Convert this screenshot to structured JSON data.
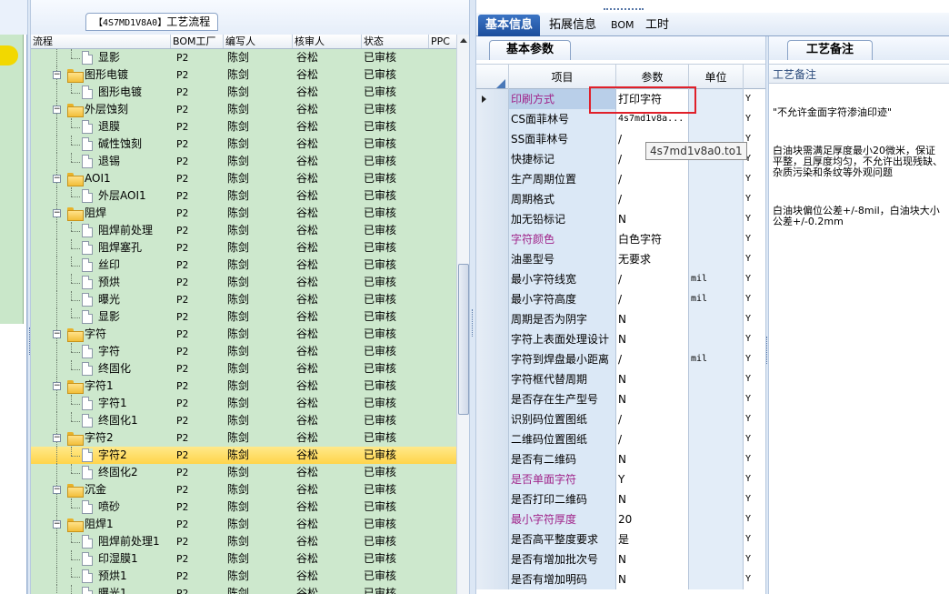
{
  "tree_panel": {
    "title_code": "【4S7MD1V8A0】",
    "title_text": "工艺流程",
    "columns": [
      "流程",
      "BOM工厂",
      "编写人",
      "核审人",
      "状态",
      "PPC"
    ],
    "rows": [
      {
        "name": "显影",
        "level": 2,
        "bom": "P2",
        "writer": "陈剑",
        "reviewer": "谷松",
        "status": "已审核"
      },
      {
        "name": "图形电镀",
        "level": 1,
        "bom": "P2",
        "writer": "陈剑",
        "reviewer": "谷松",
        "status": "已审核"
      },
      {
        "name": "图形电镀",
        "level": 2,
        "bom": "P2",
        "writer": "陈剑",
        "reviewer": "谷松",
        "status": "已审核"
      },
      {
        "name": "外层蚀刻",
        "level": 1,
        "bom": "P2",
        "writer": "陈剑",
        "reviewer": "谷松",
        "status": "已审核"
      },
      {
        "name": "退膜",
        "level": 2,
        "bom": "P2",
        "writer": "陈剑",
        "reviewer": "谷松",
        "status": "已审核"
      },
      {
        "name": "碱性蚀刻",
        "level": 2,
        "bom": "P2",
        "writer": "陈剑",
        "reviewer": "谷松",
        "status": "已审核"
      },
      {
        "name": "退锡",
        "level": 2,
        "bom": "P2",
        "writer": "陈剑",
        "reviewer": "谷松",
        "status": "已审核"
      },
      {
        "name": "AOI1",
        "level": 1,
        "bom": "P2",
        "writer": "陈剑",
        "reviewer": "谷松",
        "status": "已审核"
      },
      {
        "name": "外层AOI1",
        "level": 2,
        "bom": "P2",
        "writer": "陈剑",
        "reviewer": "谷松",
        "status": "已审核"
      },
      {
        "name": "阻焊",
        "level": 1,
        "bom": "P2",
        "writer": "陈剑",
        "reviewer": "谷松",
        "status": "已审核"
      },
      {
        "name": "阻焊前处理",
        "level": 2,
        "bom": "P2",
        "writer": "陈剑",
        "reviewer": "谷松",
        "status": "已审核"
      },
      {
        "name": "阻焊塞孔",
        "level": 2,
        "bom": "P2",
        "writer": "陈剑",
        "reviewer": "谷松",
        "status": "已审核"
      },
      {
        "name": "丝印",
        "level": 2,
        "bom": "P2",
        "writer": "陈剑",
        "reviewer": "谷松",
        "status": "已审核"
      },
      {
        "name": "预烘",
        "level": 2,
        "bom": "P2",
        "writer": "陈剑",
        "reviewer": "谷松",
        "status": "已审核"
      },
      {
        "name": "曝光",
        "level": 2,
        "bom": "P2",
        "writer": "陈剑",
        "reviewer": "谷松",
        "status": "已审核"
      },
      {
        "name": "显影",
        "level": 2,
        "bom": "P2",
        "writer": "陈剑",
        "reviewer": "谷松",
        "status": "已审核"
      },
      {
        "name": "字符",
        "level": 1,
        "bom": "P2",
        "writer": "陈剑",
        "reviewer": "谷松",
        "status": "已审核"
      },
      {
        "name": "字符",
        "level": 2,
        "bom": "P2",
        "writer": "陈剑",
        "reviewer": "谷松",
        "status": "已审核"
      },
      {
        "name": "终固化",
        "level": 2,
        "bom": "P2",
        "writer": "陈剑",
        "reviewer": "谷松",
        "status": "已审核"
      },
      {
        "name": "字符1",
        "level": 1,
        "bom": "P2",
        "writer": "陈剑",
        "reviewer": "谷松",
        "status": "已审核"
      },
      {
        "name": "字符1",
        "level": 2,
        "bom": "P2",
        "writer": "陈剑",
        "reviewer": "谷松",
        "status": "已审核"
      },
      {
        "name": "终固化1",
        "level": 2,
        "bom": "P2",
        "writer": "陈剑",
        "reviewer": "谷松",
        "status": "已审核"
      },
      {
        "name": "字符2",
        "level": 1,
        "bom": "P2",
        "writer": "陈剑",
        "reviewer": "谷松",
        "status": "已审核"
      },
      {
        "name": "字符2",
        "level": 2,
        "bom": "P2",
        "writer": "陈剑",
        "reviewer": "谷松",
        "status": "已审核",
        "selected": true
      },
      {
        "name": "终固化2",
        "level": 2,
        "bom": "P2",
        "writer": "陈剑",
        "reviewer": "谷松",
        "status": "已审核"
      },
      {
        "name": "沉金",
        "level": 1,
        "bom": "P2",
        "writer": "陈剑",
        "reviewer": "谷松",
        "status": "已审核"
      },
      {
        "name": "喷砂",
        "level": 2,
        "bom": "P2",
        "writer": "陈剑",
        "reviewer": "谷松",
        "status": "已审核"
      },
      {
        "name": "阻焊1",
        "level": 1,
        "bom": "P2",
        "writer": "陈剑",
        "reviewer": "谷松",
        "status": "已审核"
      },
      {
        "name": "阻焊前处理1",
        "level": 2,
        "bom": "P2",
        "writer": "陈剑",
        "reviewer": "谷松",
        "status": "已审核"
      },
      {
        "name": "印湿膜1",
        "level": 2,
        "bom": "P2",
        "writer": "陈剑",
        "reviewer": "谷松",
        "status": "已审核"
      },
      {
        "name": "预烘1",
        "level": 2,
        "bom": "P2",
        "writer": "陈剑",
        "reviewer": "谷松",
        "status": "已审核"
      },
      {
        "name": "曝光1",
        "level": 2,
        "bom": "P2",
        "writer": "陈剑",
        "reviewer": "谷松",
        "status": "已审核"
      }
    ]
  },
  "top_tabs": [
    {
      "label": "基本信息",
      "active": true
    },
    {
      "label": "拓展信息",
      "active": false
    },
    {
      "label": "BOM",
      "active": false
    },
    {
      "label": "工时",
      "active": false
    }
  ],
  "basic_panel": {
    "tab_label": "基本参数",
    "headers": {
      "item": "项目",
      "param": "参数",
      "unit": "单位"
    },
    "rows": [
      {
        "item": "印刷方式",
        "value": "打印字符",
        "unit": "",
        "flag": "Y",
        "highlight": true
      },
      {
        "item": "CS面菲林号",
        "value": "4s7md1v8a...",
        "unit": "",
        "flag": "Y",
        "mono": true
      },
      {
        "item": "SS面菲林号",
        "value": "/",
        "unit": "",
        "flag": "Y"
      },
      {
        "item": "快捷标记",
        "value": "/",
        "unit": "",
        "flag": "Y"
      },
      {
        "item": "生产周期位置",
        "value": "/",
        "unit": "",
        "flag": "Y"
      },
      {
        "item": "周期格式",
        "value": "/",
        "unit": "",
        "flag": "Y"
      },
      {
        "item": "加无铅标记",
        "value": "N",
        "unit": "",
        "flag": "Y"
      },
      {
        "item": "字符颜色",
        "value": "白色字符",
        "unit": "",
        "flag": "Y",
        "highlight": true
      },
      {
        "item": "油墨型号",
        "value": "无要求",
        "unit": "",
        "flag": "Y"
      },
      {
        "item": "最小字符线宽",
        "value": "/",
        "unit": "mil",
        "flag": "Y"
      },
      {
        "item": "最小字符高度",
        "value": "/",
        "unit": "mil",
        "flag": "Y"
      },
      {
        "item": "周期是否为阴字",
        "value": "N",
        "unit": "",
        "flag": "Y"
      },
      {
        "item": "字符上表面处理设计",
        "value": "N",
        "unit": "",
        "flag": "Y"
      },
      {
        "item": "字符到焊盘最小距离",
        "value": "/",
        "unit": "mil",
        "flag": "Y"
      },
      {
        "item": "字符框代替周期",
        "value": "N",
        "unit": "",
        "flag": "Y"
      },
      {
        "item": "是否存在生产型号",
        "value": "N",
        "unit": "",
        "flag": "Y"
      },
      {
        "item": "识别码位置图纸",
        "value": "/",
        "unit": "",
        "flag": "Y"
      },
      {
        "item": "二维码位置图纸",
        "value": "/",
        "unit": "",
        "flag": "Y"
      },
      {
        "item": "是否有二维码",
        "value": "N",
        "unit": "",
        "flag": "Y"
      },
      {
        "item": "是否单面字符",
        "value": "Y",
        "unit": "",
        "flag": "Y",
        "highlight": true
      },
      {
        "item": "是否打印二维码",
        "value": "N",
        "unit": "",
        "flag": "Y"
      },
      {
        "item": "最小字符厚度",
        "value": "20",
        "unit": "",
        "flag": "Y",
        "highlight": true
      },
      {
        "item": "是否高平整度要求",
        "value": "是",
        "unit": "",
        "flag": "Y"
      },
      {
        "item": "是否有增加批次号",
        "value": "N",
        "unit": "",
        "flag": "Y"
      },
      {
        "item": "是否有增加明码",
        "value": "N",
        "unit": "",
        "flag": "Y"
      }
    ]
  },
  "tooltip": "4s7md1v8a0.to1",
  "notes_panel": {
    "tab_label": "工艺备注",
    "label": "工艺备注",
    "lines": [
      "\"不允许金面字符渗油印迹\"",
      "白油块需满足厚度最小20微米，保证\n平整，且厚度均匀，不允许出现残缺、\n杂质污染和条纹等外观问题",
      "白油块偏位公差+/-8mil，白油块大小\n公差+/-0.2mm"
    ]
  },
  "colors": {
    "tree_bg": "#cde8cd",
    "selected_row": "#ffd44a",
    "accent": "#1d4e9c",
    "highlight_text": "#a0248a",
    "annotation_box": "#e0202a"
  }
}
